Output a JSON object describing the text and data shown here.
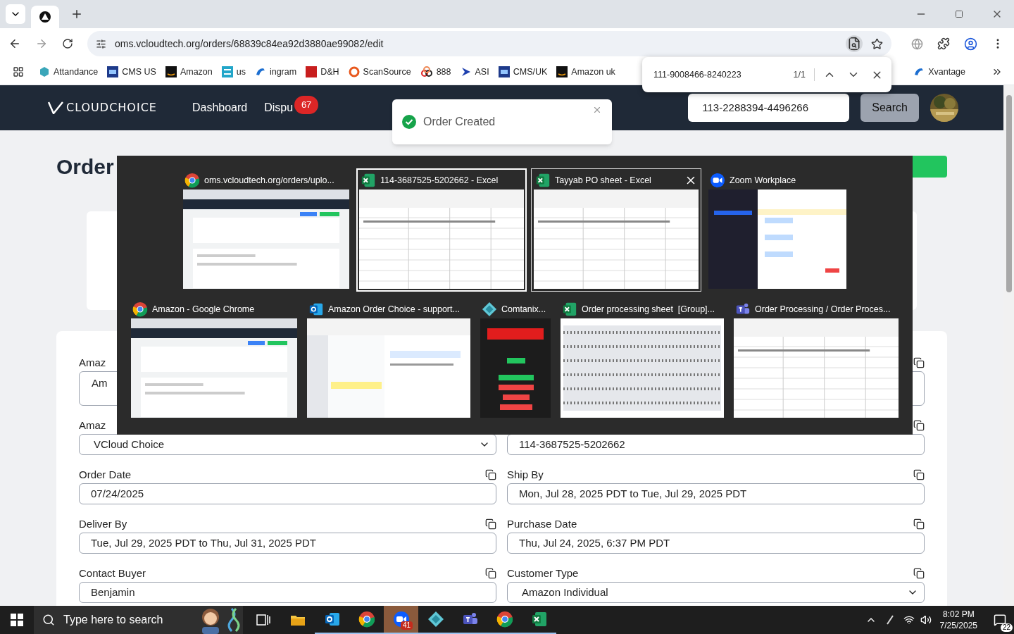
{
  "address_bar": {
    "url": "oms.vcloudtech.org/orders/68839c84ea92d3880ae99082/edit"
  },
  "bookmarks": [
    {
      "label": "Attandance"
    },
    {
      "label": "CMS US"
    },
    {
      "label": "Amazon"
    },
    {
      "label": "us"
    },
    {
      "label": "ingram"
    },
    {
      "label": "D&H"
    },
    {
      "label": "ScanSource"
    },
    {
      "label": "888"
    },
    {
      "label": "ASI"
    },
    {
      "label": "CMS/UK"
    },
    {
      "label": "Amazon uk"
    },
    {
      "label": "Xvantage"
    }
  ],
  "find_bar": {
    "query": "111-9008466-8240223",
    "count": "1/1"
  },
  "app_header": {
    "logo": "CLOUDCHOICE",
    "nav": [
      {
        "label": "Dashboard"
      },
      {
        "label": "Dispu",
        "badge": "67"
      }
    ],
    "search": {
      "value": "113-2288394-4496266"
    },
    "search_button": "Search"
  },
  "toast": {
    "message": "Order Created"
  },
  "page": {
    "title": "Order"
  },
  "form": {
    "fields": [
      {
        "label": "Amaz",
        "value": "Am",
        "kind": "textarea",
        "copy_icon": false
      },
      {
        "kind": "textarea",
        "copy_icon": true
      },
      {
        "label": "Amaz",
        "value": "VCloud Choice",
        "kind": "select",
        "copy_icon": false
      },
      {
        "value": "114-3687525-5202662",
        "kind": "text",
        "copy_icon": true
      },
      {
        "label": "Order Date",
        "value": "07/24/2025",
        "kind": "text",
        "copy_icon": true
      },
      {
        "label": "Ship By",
        "value": "Mon, Jul 28, 2025 PDT to Tue, Jul 29, 2025 PDT",
        "kind": "text",
        "copy_icon": true
      },
      {
        "label": "Deliver By",
        "value": "Tue, Jul 29, 2025 PDT to Thu, Jul 31, 2025 PDT",
        "kind": "text",
        "copy_icon": true
      },
      {
        "label": "Purchase Date",
        "value": "Thu, Jul 24, 2025, 6:37 PM PDT",
        "kind": "text",
        "copy_icon": true
      },
      {
        "label": "Contact Buyer",
        "value": "Benjamin",
        "kind": "text",
        "copy_icon": true
      },
      {
        "label": "Customer Type",
        "value": "Amazon Individual",
        "kind": "select",
        "copy_icon": true
      }
    ]
  },
  "task_switcher": {
    "windows": [
      {
        "title": "oms.vcloudtech.org/orders/uplo...",
        "kind": "chrome",
        "selected": false,
        "hovered": false
      },
      {
        "title": "114-3687525-5202662 - Excel",
        "kind": "excel",
        "selected": true,
        "hovered": false
      },
      {
        "title": "Tayyab PO sheet - Excel",
        "kind": "excel",
        "selected": false,
        "hovered": true
      },
      {
        "title": "Zoom Workplace",
        "kind": "zoom",
        "selected": false,
        "hovered": false
      },
      {
        "title": "Amazon - Google Chrome",
        "kind": "chrome",
        "selected": false,
        "hovered": false
      },
      {
        "title": "Amazon Order Choice - support...",
        "kind": "outlook",
        "selected": false,
        "hovered": false
      },
      {
        "title": "Comtanix...",
        "kind": "comtanix",
        "selected": false,
        "hovered": false
      },
      {
        "title": "Order processing sheet  [Group]...",
        "kind": "excel",
        "selected": false,
        "hovered": false
      },
      {
        "title": "Order Processing / Order Proces...",
        "kind": "teams",
        "selected": false,
        "hovered": false
      }
    ]
  },
  "taskbar": {
    "search_placeholder": "Type here to search",
    "apps": [
      {
        "kind": "taskview",
        "running": false
      },
      {
        "kind": "explorer",
        "running": false
      },
      {
        "kind": "outlook",
        "running": true
      },
      {
        "kind": "chrome",
        "running": true
      },
      {
        "kind": "zoom",
        "running": true,
        "badge": "41"
      },
      {
        "kind": "comtanix",
        "running": true
      },
      {
        "kind": "teams",
        "running": true
      },
      {
        "kind": "chrome",
        "running": true
      },
      {
        "kind": "excel",
        "running": true
      }
    ],
    "time": "8:02 PM",
    "date": "7/25/2025",
    "notifications": "22"
  }
}
